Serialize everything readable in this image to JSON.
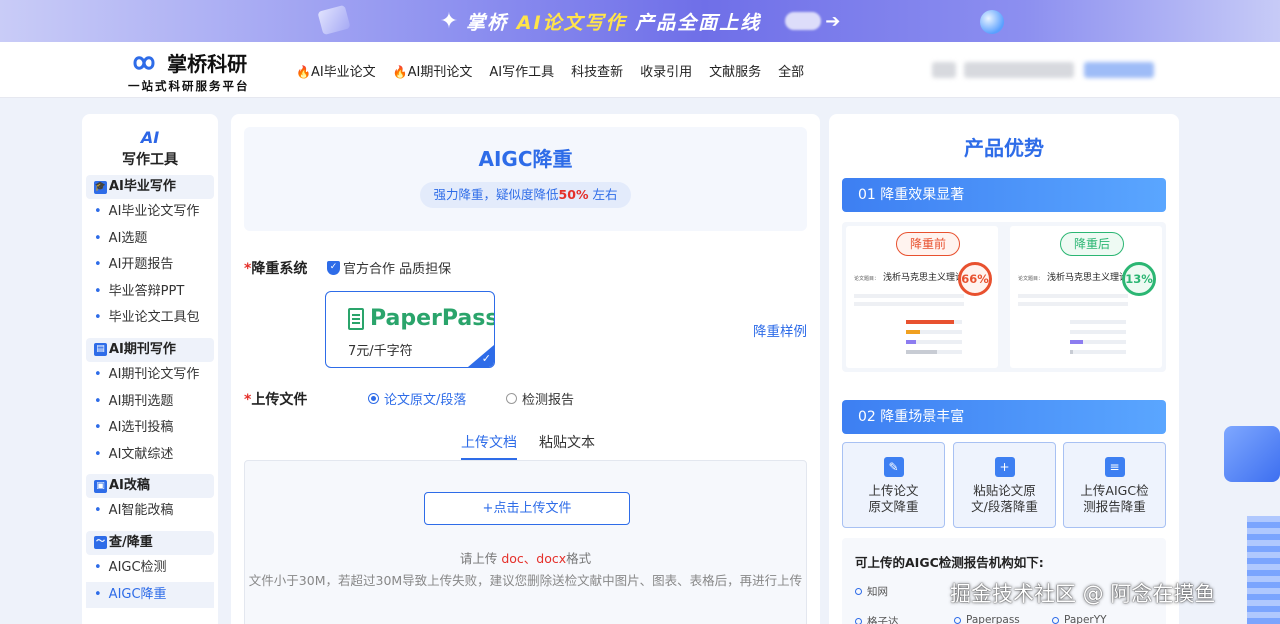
{
  "banner": {
    "brand": "掌桥",
    "highlight": "AI论文写作",
    "rest": "产品全面上线",
    "arrow": "➔"
  },
  "header": {
    "logo_name": "掌桥科研",
    "logo_slogan": "一站式科研服务平台",
    "nav": [
      {
        "label": "AI毕业论文",
        "fire": true
      },
      {
        "label": "AI期刊论文",
        "fire": true
      },
      {
        "label": "AI写作工具",
        "fire": false
      },
      {
        "label": "科技查新",
        "fire": false
      },
      {
        "label": "收录引用",
        "fire": false
      },
      {
        "label": "文献服务",
        "fire": false
      },
      {
        "label": "全部",
        "fire": false
      }
    ]
  },
  "sidebar": {
    "icon_text": "AI",
    "title": "写作工具",
    "groups": [
      {
        "title": "AI毕业写作",
        "items": [
          "AI毕业论文写作",
          "AI选题",
          "AI开题报告",
          "毕业答辩PPT",
          "毕业论文工具包"
        ]
      },
      {
        "title": "AI期刊写作",
        "items": [
          "AI期刊论文写作",
          "AI期刊选题",
          "AI选刊投稿",
          "AI文献综述"
        ]
      },
      {
        "title": "AI改稿",
        "items": [
          "AI智能改稿"
        ]
      },
      {
        "title": "查/降重",
        "items": [
          "AIGC检测",
          "AIGC降重"
        ]
      }
    ],
    "active_item": "AIGC降重"
  },
  "main": {
    "title": "AIGC降重",
    "tag_prefix": "强力降重，疑似度降低",
    "tag_percent": "50%",
    "tag_suffix": " 左右",
    "system_label": "降重系统",
    "official_text": "官方合作 品质担保",
    "product_name": "PaperPass",
    "product_price": "7元/千字符",
    "sample_link": "降重样例",
    "upload_label": "上传文件",
    "radio_options": [
      "论文原文/段落",
      "检测报告"
    ],
    "radio_selected": 0,
    "tabs": [
      "上传文档",
      "粘贴文本"
    ],
    "active_tab": 0,
    "upload_button": "+点击上传文件",
    "hint_prefix": "请上传 ",
    "hint_formats": "doc、docx",
    "hint_suffix": "格式",
    "hint_size": "文件小于30M，若超过30M导致上传失败，建议您删除送检文献中图片、图表、表格后，再进行上传"
  },
  "right": {
    "title": "产品优势",
    "section1": "01 降重效果显著",
    "section2": "02 降重场景丰富",
    "before": {
      "badge": "降重前",
      "paper_label": "论文题目：",
      "paper_title": "浅析马克思主义理论",
      "percent": "66%",
      "color": "#e8512f"
    },
    "after": {
      "badge": "降重后",
      "paper_label": "论文题目：",
      "paper_title": "浅析马克思主义理论",
      "percent": "13%",
      "color": "#2bb673"
    },
    "features": [
      "上传论文\n原文降重",
      "粘贴论文原\n文/段落降重",
      "上传AIGC检\n测报告降重"
    ],
    "org_title": "可上传的AIGC检测报告机构如下:",
    "orgs": [
      "知网",
      "格子达",
      "Paperpass",
      "PaperYY"
    ]
  },
  "watermark": "掘金技术社区 @ 阿念在摸鱼"
}
